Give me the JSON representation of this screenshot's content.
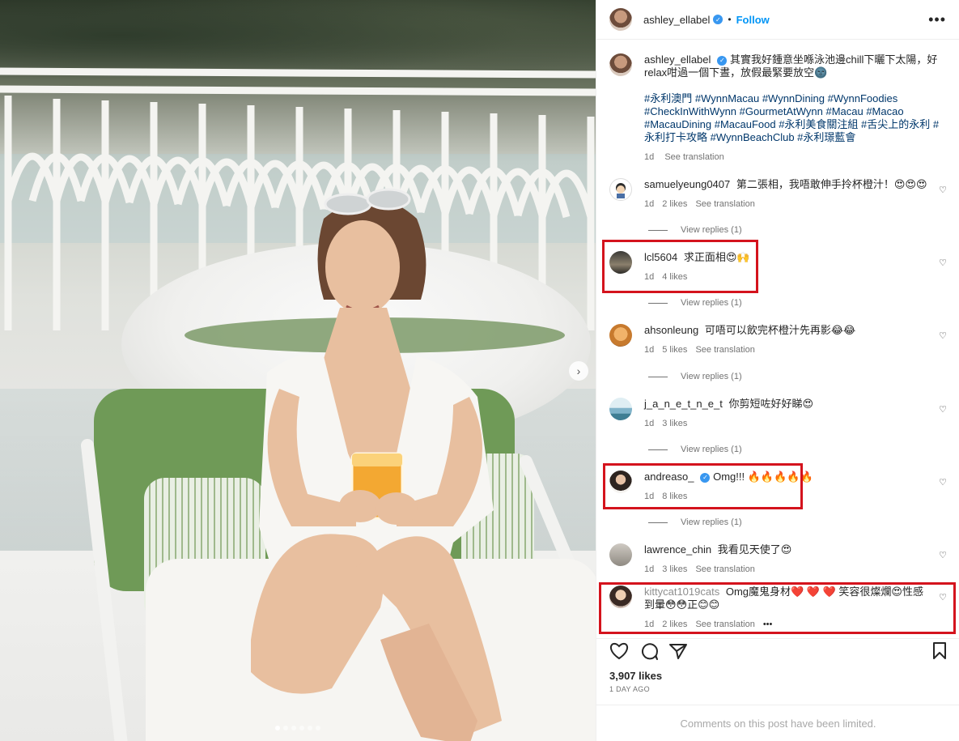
{
  "post": {
    "author": "ashley_ellabel",
    "follow_label": "Follow",
    "separator": "•",
    "caption_text": "其實我好鍾意坐喺泳池邊chill下曬下太陽，好relax咁過一個下晝，放假最緊要放空🌚",
    "hashtags": "#永利澳門 #WynnMacau #WynnDining #WynnFoodies #CheckInWithWynn #GourmetAtWynn #Macau #Macao #MacauDining #MacauFood #永利美食關注組 #舌尖上的永利 #永利打卡攻略 #WynnBeachClub #永利璟藍會",
    "caption_time": "1d",
    "see_translation": "See translation",
    "likes": "3,907 likes",
    "time_ago": "1 DAY AGO",
    "limited_notice": "Comments on this post have been limited."
  },
  "comments": [
    {
      "user": "samuelyeung0407",
      "text": "第二張相，我唔敢伸手拎杯橙汁！😍😍😍",
      "time": "1d",
      "likes": "2 likes",
      "translation": "See translation",
      "view_replies": "View replies (1)",
      "avatar_color": "#e8e2d8"
    },
    {
      "user": "lcl5604",
      "text": "求正面相😍🙌",
      "time": "1d",
      "likes": "4 likes",
      "translation": "",
      "view_replies": "View replies (1)",
      "avatar_color": "#7d7466"
    },
    {
      "user": "ahsonleung",
      "text": "可唔可以飲完杯橙汁先再影😂😂",
      "time": "1d",
      "likes": "5 likes",
      "translation": "See translation",
      "view_replies": "View replies (1)",
      "avatar_color": "#d98a3a"
    },
    {
      "user": "j_a_n_e_t_n_e_t",
      "text": "你剪短咗好好睇😍",
      "time": "1d",
      "likes": "3 likes",
      "translation": "",
      "view_replies": "View replies (1)",
      "avatar_color": "#7fb3c9"
    },
    {
      "user": "andreaso_",
      "text": "Omg!!! 🔥🔥🔥🔥🔥",
      "time": "1d",
      "likes": "8 likes",
      "translation": "",
      "view_replies": "View replies (1)",
      "avatar_color": "#3b2f2a"
    },
    {
      "user": "lawrence_chin",
      "text": "我看见天使了😍",
      "time": "1d",
      "likes": "3 likes",
      "translation": "See translation",
      "view_replies": "",
      "avatar_color": "#b7b2aa"
    },
    {
      "user": "kittycat1019cats",
      "text": "Omg魔鬼身材❤️ ❤️ ❤️ 笑容很燦爛😍性感到暈😳😳正😊😊",
      "time": "1d",
      "likes": "2 likes",
      "translation": "See translation",
      "view_replies": "",
      "avatar_color": "#4a3a34",
      "more": "•••"
    }
  ],
  "icons": {
    "like": "heart-icon",
    "comment": "comment-icon",
    "share": "share-icon",
    "save": "bookmark-icon",
    "more": "more-options-icon",
    "next": "chevron-right-icon"
  },
  "accent_colors": {
    "follow": "#0095f6",
    "hashtag": "#00376b",
    "verified": "#3897f0",
    "highlight": "#d4131d"
  }
}
